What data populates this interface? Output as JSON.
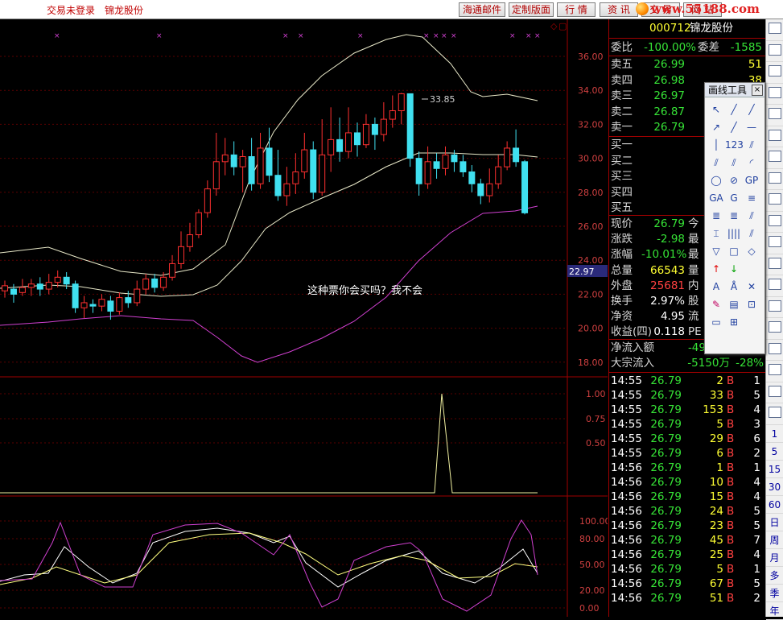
{
  "topbar": {
    "login_status": "交易未登录",
    "stock_name": "锦龙股份",
    "buttons": [
      "海通邮件",
      "定制版面",
      "行 情",
      "资 讯",
      "交 易",
      "网 站"
    ],
    "logo_text": "www.55188.com"
  },
  "chart": {
    "price_axis": [
      "36.00",
      "34.00",
      "32.00",
      "30.00",
      "28.00",
      "26.00",
      "24.00",
      "22.00",
      "20.00",
      "18.00"
    ],
    "current_price_marker": "22.97",
    "high_label": "33.85",
    "comment": "这种票你会买吗？我不会",
    "mid_axis": [
      "1.00",
      "0.75",
      "0.50"
    ],
    "kdj_axis": [
      "100.00",
      "80.00",
      "50.00",
      "20.00",
      "0.00"
    ],
    "colors": {
      "up": "#ff3030",
      "down": "#40e0f0",
      "upper_band": "#e8e8c8",
      "lower_band": "#d040d0",
      "axis": "#a00000"
    }
  },
  "quote": {
    "code": "000712",
    "name": "锦龙股份",
    "weibi_label": "委比",
    "weibi": "-100.00%",
    "weicha_label": "委差",
    "weicha": "-1585",
    "sell": [
      {
        "label": "卖五",
        "price": "26.99",
        "vol": "51"
      },
      {
        "label": "卖四",
        "price": "26.98",
        "vol": "38"
      },
      {
        "label": "卖三",
        "price": "26.97",
        "vol": ""
      },
      {
        "label": "卖二",
        "price": "26.87",
        "vol": ""
      },
      {
        "label": "卖一",
        "price": "26.79",
        "vol": ""
      }
    ],
    "buy": [
      {
        "label": "买一"
      },
      {
        "label": "买二"
      },
      {
        "label": "买三"
      },
      {
        "label": "买四"
      },
      {
        "label": "买五"
      }
    ],
    "stats": [
      {
        "label": "现价",
        "value": "26.79",
        "label2": "今"
      },
      {
        "label": "涨跌",
        "value": "-2.98",
        "label2": "最"
      },
      {
        "label": "涨幅",
        "value": "-10.01%",
        "label2": "最"
      },
      {
        "label": "总量",
        "value": "66543",
        "label2": "量"
      },
      {
        "label": "外盘",
        "value": "25681",
        "label2": "内"
      },
      {
        "label": "换手",
        "value": "2.97%",
        "label2": "股"
      },
      {
        "label": "净资",
        "value": "4.95",
        "label2": "流"
      },
      {
        "label": "收益(四)",
        "value": "0.118",
        "label2": "PE"
      }
    ],
    "flow": [
      {
        "label": "净流入额",
        "value": "-49"
      },
      {
        "label": "大宗流入",
        "value": "-5150万",
        "pct": "-28%"
      }
    ]
  },
  "ticks": [
    {
      "time": "14:55",
      "price": "26.79",
      "vol": "2",
      "bs": "B",
      "n": "1"
    },
    {
      "time": "14:55",
      "price": "26.79",
      "vol": "33",
      "bs": "B",
      "n": "5"
    },
    {
      "time": "14:55",
      "price": "26.79",
      "vol": "153",
      "bs": "B",
      "n": "4"
    },
    {
      "time": "14:55",
      "price": "26.79",
      "vol": "5",
      "bs": "B",
      "n": "3"
    },
    {
      "time": "14:55",
      "price": "26.79",
      "vol": "29",
      "bs": "B",
      "n": "6"
    },
    {
      "time": "14:55",
      "price": "26.79",
      "vol": "6",
      "bs": "B",
      "n": "2"
    },
    {
      "time": "14:56",
      "price": "26.79",
      "vol": "1",
      "bs": "B",
      "n": "1"
    },
    {
      "time": "14:56",
      "price": "26.79",
      "vol": "10",
      "bs": "B",
      "n": "4"
    },
    {
      "time": "14:56",
      "price": "26.79",
      "vol": "15",
      "bs": "B",
      "n": "4"
    },
    {
      "time": "14:56",
      "price": "26.79",
      "vol": "24",
      "bs": "B",
      "n": "5"
    },
    {
      "time": "14:56",
      "price": "26.79",
      "vol": "23",
      "bs": "B",
      "n": "5"
    },
    {
      "time": "14:56",
      "price": "26.79",
      "vol": "45",
      "bs": "B",
      "n": "7"
    },
    {
      "time": "14:56",
      "price": "26.79",
      "vol": "25",
      "bs": "B",
      "n": "4"
    },
    {
      "time": "14:56",
      "price": "26.79",
      "vol": "5",
      "bs": "B",
      "n": "1"
    },
    {
      "time": "14:56",
      "price": "26.79",
      "vol": "67",
      "bs": "B",
      "n": "5"
    },
    {
      "time": "14:56",
      "price": "26.79",
      "vol": "51",
      "bs": "B",
      "n": "2"
    }
  ],
  "toolbox": {
    "title": "画线工具",
    "close": "×"
  },
  "sidebar": {
    "labels": [
      "1",
      "5",
      "15",
      "30",
      "60",
      "日",
      "周",
      "月",
      "多",
      "季",
      "年"
    ]
  }
}
